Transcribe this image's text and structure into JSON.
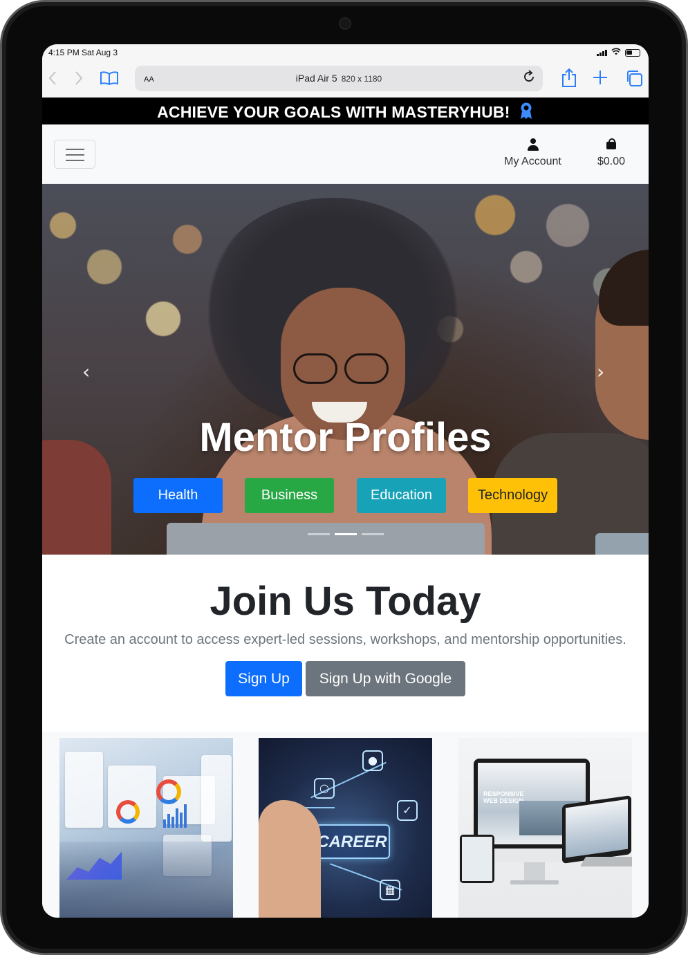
{
  "status_bar": {
    "time": "4:15 PM Sat Aug 3"
  },
  "browser": {
    "text_size_label": "AA",
    "device_name": "iPad Air 5",
    "device_resolution": "820 x 1180",
    "icons": [
      "back-icon",
      "forward-icon",
      "bookmarks-icon",
      "reload-icon",
      "share-icon",
      "new-tab-icon",
      "tabs-icon"
    ]
  },
  "banner": {
    "text": "ACHIEVE YOUR GOALS WITH MASTERYHUB!",
    "icon": "award-icon"
  },
  "navbar": {
    "account_label": "My Account",
    "cart_total": "$0.00"
  },
  "hero": {
    "title": "Mentor Profiles",
    "active_slide": 2,
    "slide_count": 3,
    "categories": [
      {
        "label": "Health",
        "color": "#0d6efd"
      },
      {
        "label": "Business",
        "color": "#28a745"
      },
      {
        "label": "Education",
        "color": "#17a2b8"
      },
      {
        "label": "Technology",
        "color": "#ffc107"
      }
    ]
  },
  "join": {
    "title": "Join Us Today",
    "subtitle": "Create an account to access expert-led sessions, workshops, and mentorship opportunities.",
    "signup_label": "Sign Up",
    "google_label": "Sign Up with Google"
  },
  "cards": {
    "career_label": "CAREER",
    "web_design_label": "RESPONSIVE WEB DESIGN"
  },
  "colors": {
    "primary": "#0d6efd",
    "secondary": "#6c757d",
    "success": "#28a745",
    "info": "#17a2b8",
    "warning": "#ffc107",
    "safari_accent": "#2d7ff9"
  }
}
